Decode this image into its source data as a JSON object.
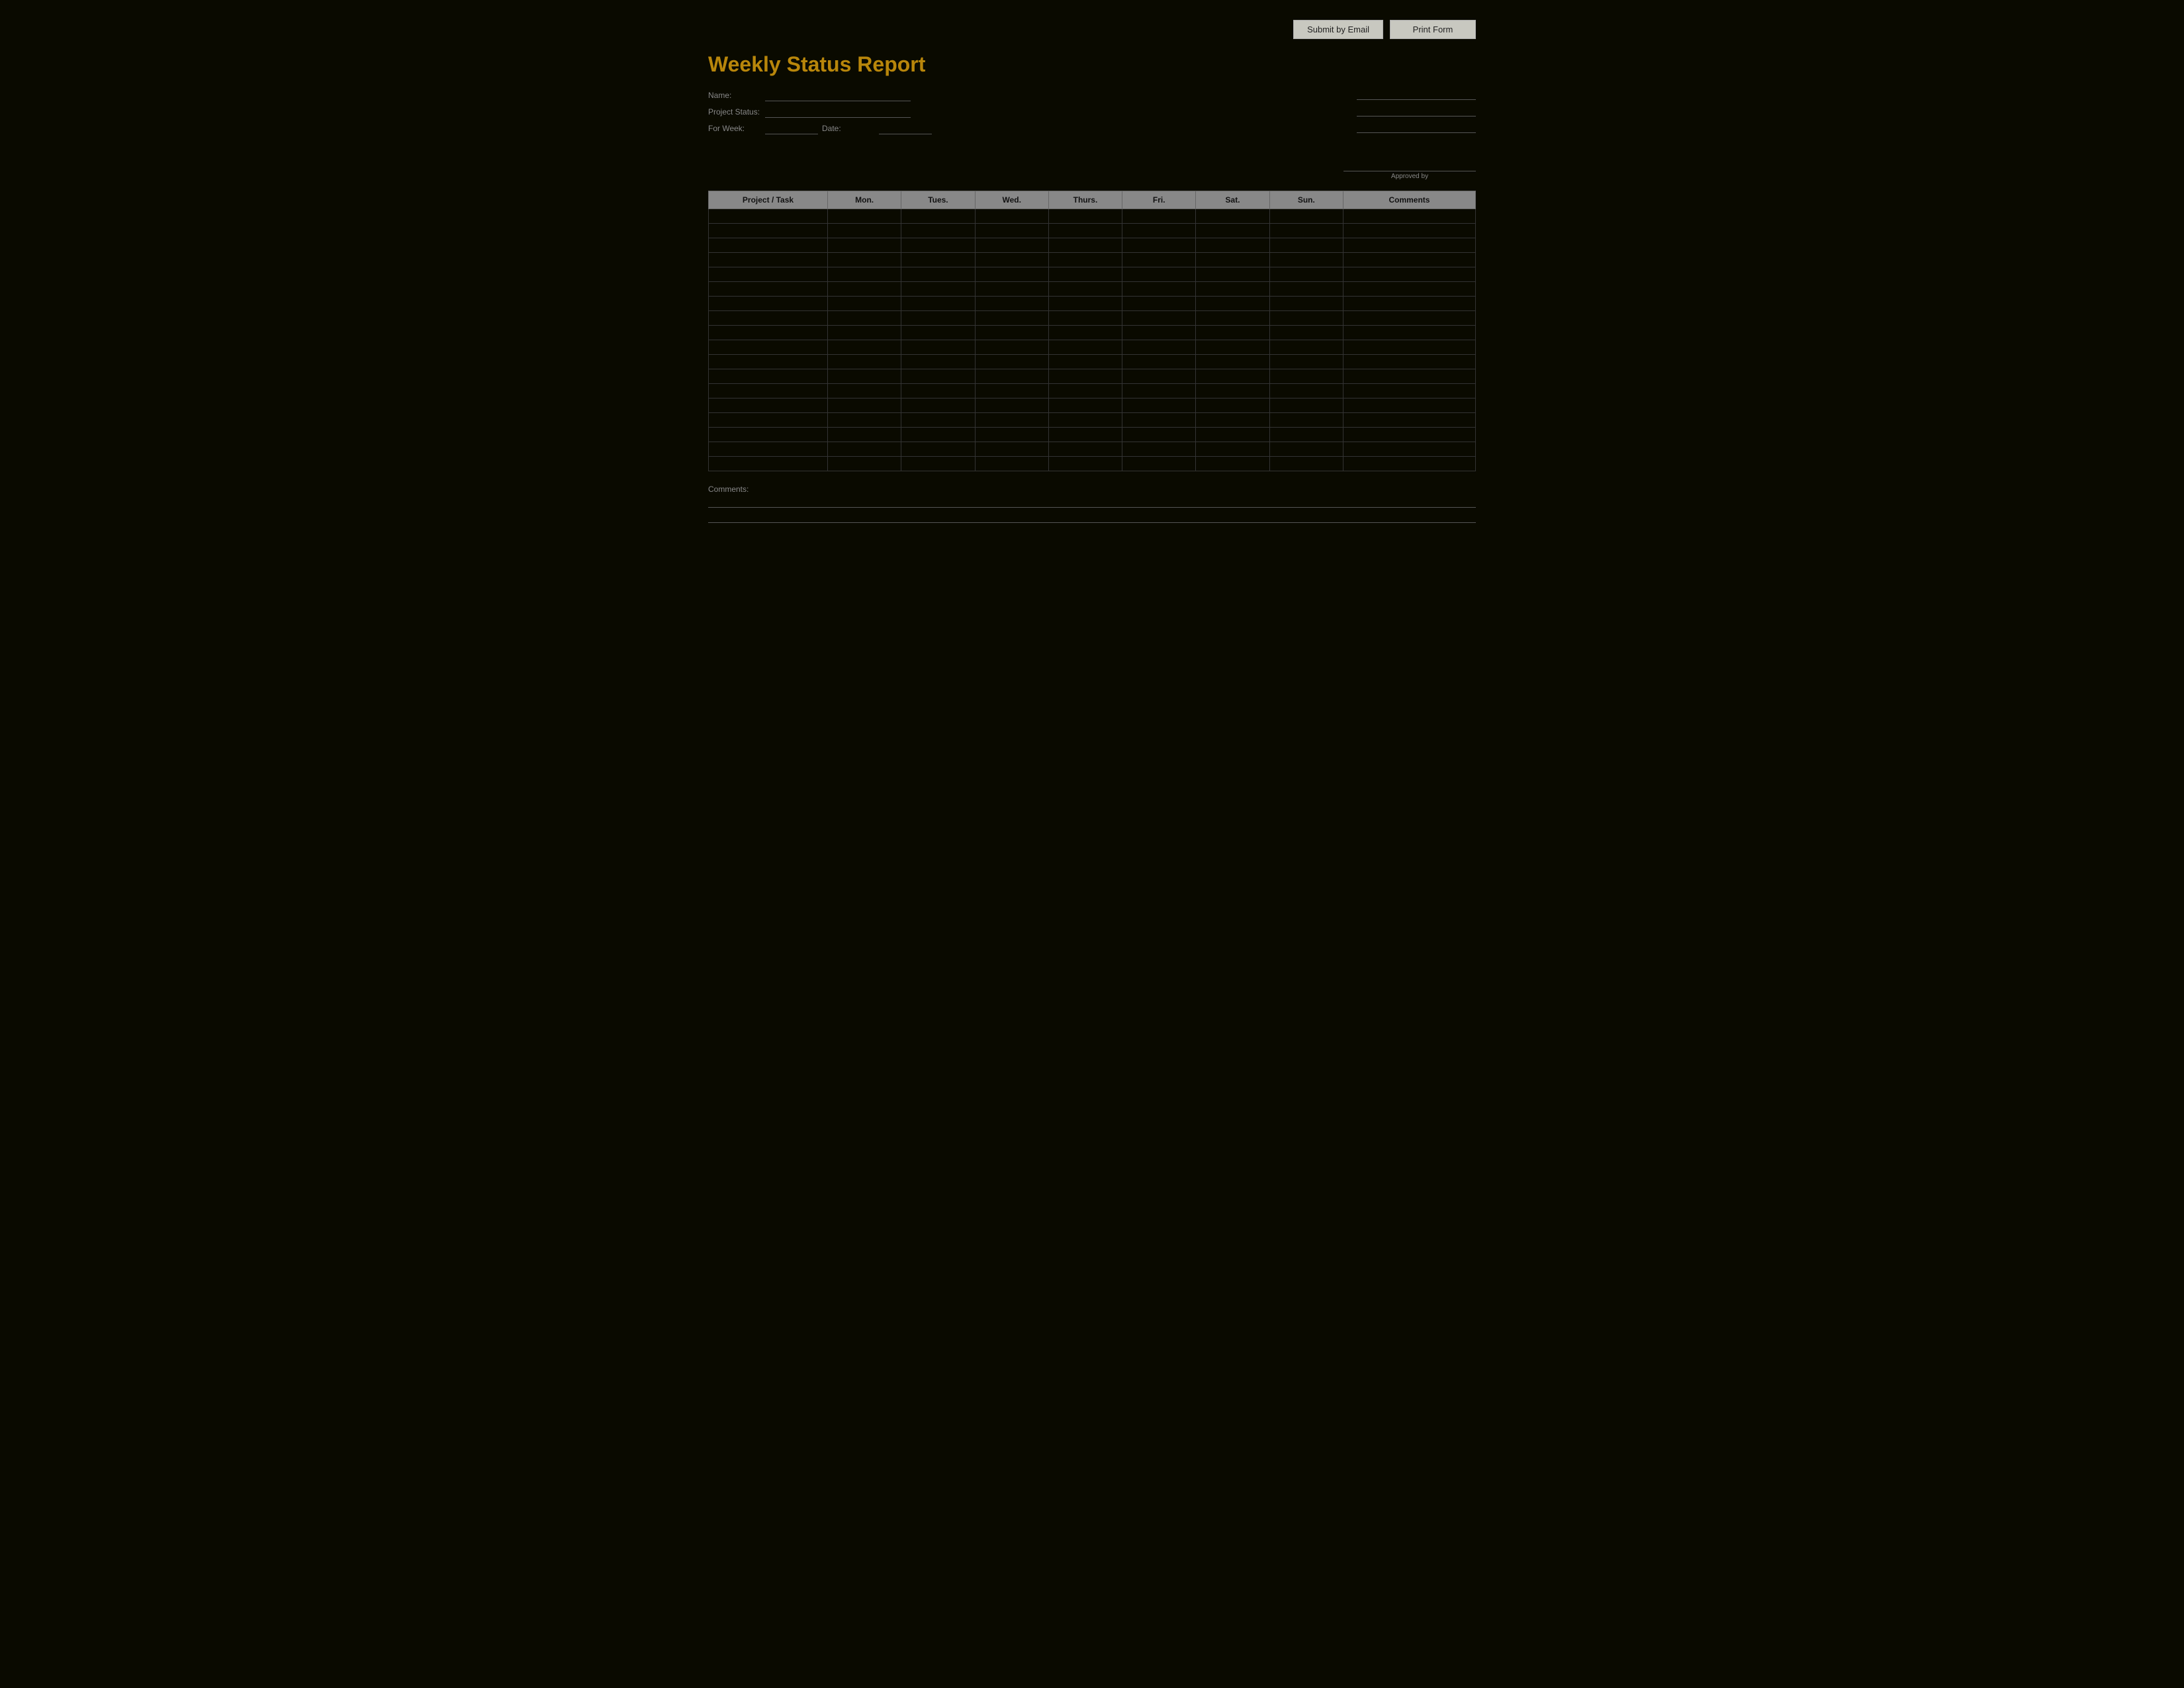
{
  "toolbar": {
    "submit_email_label": "Submit by Email",
    "print_form_label": "Print Form"
  },
  "header": {
    "title": "Weekly Status Report"
  },
  "form": {
    "fields": {
      "name_label": "Name:",
      "name_value": "",
      "project_status_label": "Project Status:",
      "project_status_value": "",
      "for_week_label": "For Week:",
      "for_week_value": "",
      "date_label": "Date:",
      "date_value": ""
    },
    "right_fields": {
      "row1_label": "",
      "row1_value": "",
      "row2_label": "",
      "row2_value": "",
      "row3_label": "",
      "row3_value": ""
    },
    "signature_label": "Approved by"
  },
  "table": {
    "headers": [
      "Project / Task",
      "Mon.",
      "Tues.",
      "Wed.",
      "Thurs.",
      "Fri.",
      "Sat.",
      "Sun.",
      "Comments"
    ],
    "rows": 18
  },
  "footer": {
    "comments_label": "Comments:",
    "comments_value": ""
  }
}
